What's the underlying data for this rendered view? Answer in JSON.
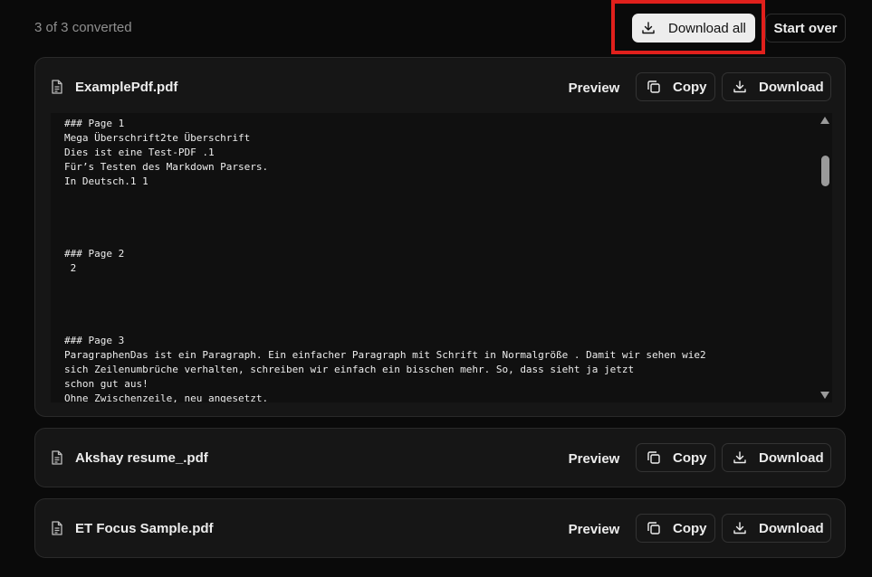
{
  "header": {
    "status": "3 of 3 converted",
    "download_all_label": "Download all",
    "start_over_label": "Start over"
  },
  "files": [
    {
      "name": "ExamplePdf.pdf",
      "preview_label": "Preview",
      "copy_label": "Copy",
      "download_label": "Download",
      "content": "### Page 1\nMega Überschrift2te Überschrift\nDies ist eine Test-PDF .1\nFür’s Testen des Markdown Parsers.\nIn Deutsch.1 1\n\n\n\n\n### Page 2\n 2\n\n\n\n\n### Page 3\nParagraphenDas ist ein Paragraph. Ein einfacher Paragraph mit Schrift in Normalgröße . Damit wir sehen wie2\nsich Zeilenumbrüche verhalten, schreiben wir einfach ein bisschen mehr. So, dass sieht ja jetzt\nschon gut aus!\nOhne Zwischenzeile, neu angesetzt.\nMit Zwischenzeile, neu angesetzt.\nUnd nachfolgend ein etwas längerer Tex:"
    },
    {
      "name": "Akshay resume_.pdf",
      "preview_label": "Preview",
      "copy_label": "Copy",
      "download_label": "Download"
    },
    {
      "name": "ET Focus Sample.pdf",
      "preview_label": "Preview",
      "copy_label": "Copy",
      "download_label": "Download"
    }
  ],
  "icons": {
    "file": "file-text-icon",
    "copy": "copy-icon",
    "download": "download-icon"
  },
  "colors": {
    "background": "#0a0a0a",
    "card": "#161616",
    "highlight": "#e0201c",
    "primary_button": "#ededed"
  }
}
